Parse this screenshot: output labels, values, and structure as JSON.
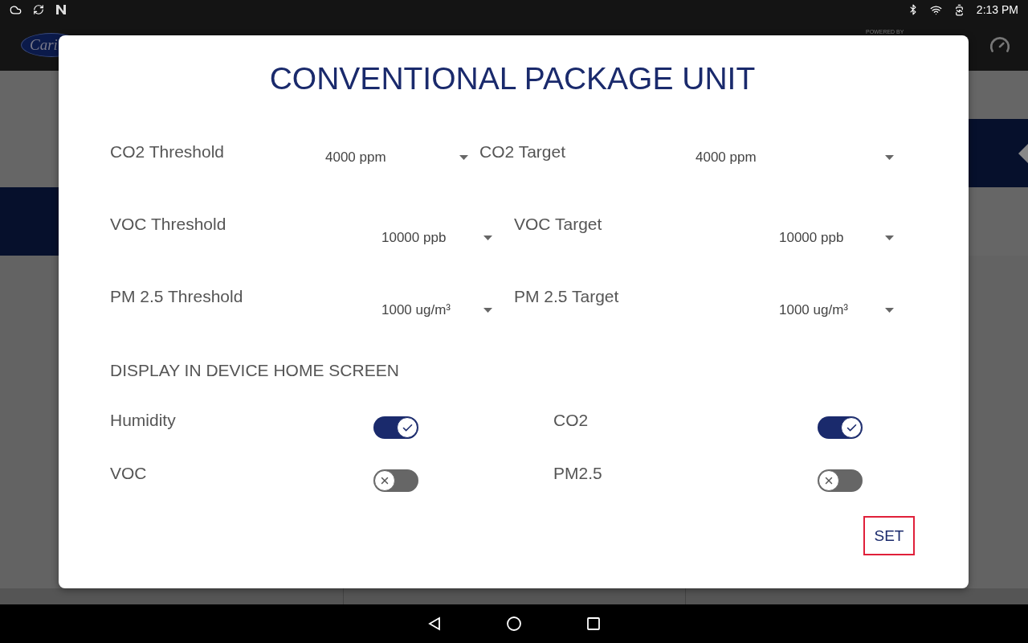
{
  "status_bar": {
    "time": "2:13 PM"
  },
  "header": {
    "logo_text": "Cari",
    "powered_by": "POWERED BY"
  },
  "dialog": {
    "title": "CONVENTIONAL PACKAGE UNIT",
    "fields": [
      {
        "label": "CO2 Threshold",
        "value": "4000 ppm"
      },
      {
        "label": "CO2 Target",
        "value": "4000 ppm"
      },
      {
        "label": "VOC Threshold",
        "value": "10000 ppb"
      },
      {
        "label": "VOC Target",
        "value": "10000 ppb"
      },
      {
        "label": "PM 2.5 Threshold",
        "value": "1000 ug/m³"
      },
      {
        "label": "PM 2.5 Target",
        "value": "1000 ug/m³"
      }
    ],
    "section_title": "DISPLAY IN DEVICE HOME SCREEN",
    "toggles": [
      {
        "label": "Humidity",
        "on": true
      },
      {
        "label": "CO2",
        "on": true
      },
      {
        "label": "VOC",
        "on": false
      },
      {
        "label": "PM2.5",
        "on": false
      }
    ],
    "button": "SET"
  }
}
